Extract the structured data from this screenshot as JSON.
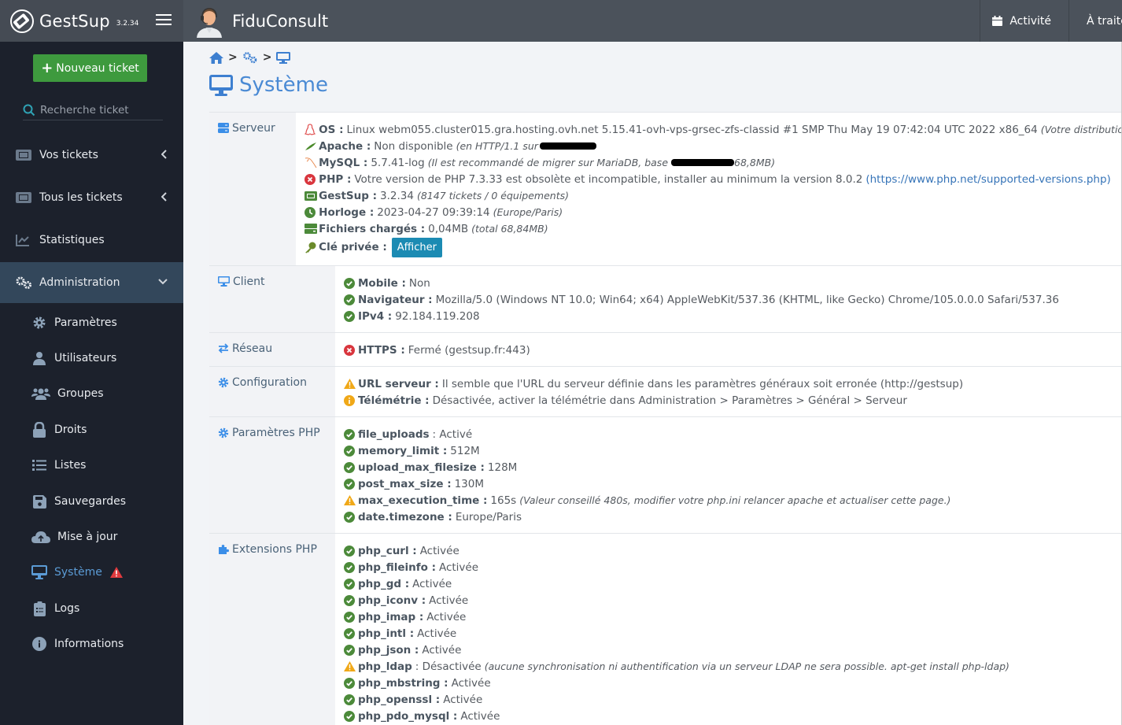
{
  "app": {
    "name": "GestSup",
    "version": "3.2.34",
    "organization": "FiduConsult"
  },
  "top_actions": [
    {
      "label": "Activité",
      "icon": "calendar-icon"
    },
    {
      "label": "À traiter",
      "icon": "flag-icon"
    }
  ],
  "sidebar": {
    "new_ticket_label": "Nouveau ticket",
    "search_placeholder": "Recherche ticket",
    "items": [
      {
        "label": "Vos tickets",
        "icon": "ticket-icon"
      },
      {
        "label": "Tous les tickets",
        "icon": "ticket-icon"
      },
      {
        "label": "Statistiques",
        "icon": "chart-line-icon"
      },
      {
        "label": "Administration",
        "icon": "cogs-icon"
      }
    ],
    "admin_items": [
      {
        "label": "Paramètres",
        "icon": "gear-icon"
      },
      {
        "label": "Utilisateurs",
        "icon": "user-icon"
      },
      {
        "label": "Groupes",
        "icon": "users-icon"
      },
      {
        "label": "Droits",
        "icon": "lock-icon"
      },
      {
        "label": "Listes",
        "icon": "list-icon"
      },
      {
        "label": "Sauvegardes",
        "icon": "save-icon"
      },
      {
        "label": "Mise à jour",
        "icon": "cloud-upload-icon"
      },
      {
        "label": "Système",
        "icon": "desktop-icon"
      },
      {
        "label": "Logs",
        "icon": "clipboard-list-icon"
      },
      {
        "label": "Informations",
        "icon": "info-circle-icon"
      }
    ]
  },
  "page": {
    "title": "Système",
    "breadcrumb": [
      "home-icon",
      "cogs-icon",
      "desktop-icon"
    ]
  },
  "sections": {
    "serveur": {
      "label": "Serveur",
      "os_key": "OS :",
      "os_value": "Linux webm055.cluster015.gra.hosting.ovh.net 5.15.41-ovh-vps-grsec-zfs-classid #1 SMP Thu May 19 07:42:04 UTC 2022 x86_64",
      "os_note": "(Votre distribution",
      "apache_key": "Apache :",
      "apache_value": "Non disponible",
      "apache_note": "(en HTTP/1.1 sur",
      "mysql_key": "MySQL :",
      "mysql_value": "5.7.41-log",
      "mysql_note": "(Il est recommandé de migrer sur MariaDB, base",
      "mysql_note_end": "68,8MB)",
      "php_key": "PHP :",
      "php_value": "Votre version de PHP 7.3.33 est obsolète et incompatible, installer au minimum la version 8.0.2",
      "php_link": "(https://www.php.net/supported-versions.php)",
      "gestsup_key": "GestSup :",
      "gestsup_value": "3.2.34",
      "gestsup_note": "(8147 tickets / 0 équipements)",
      "horloge_key": "Horloge :",
      "horloge_value": "2023-04-27 09:39:14",
      "horloge_note": "(Europe/Paris)",
      "fichiers_key": "Fichiers chargés :",
      "fichiers_value": "0,04MB",
      "fichiers_note": "(total 68,84MB)",
      "cle_key": "Clé privée :",
      "cle_button": "Afficher"
    },
    "client": {
      "label": "Client",
      "lines": [
        {
          "key": "Mobile :",
          "value": "Non",
          "status": "ok"
        },
        {
          "key": "Navigateur :",
          "value": "Mozilla/5.0 (Windows NT 10.0; Win64; x64) AppleWebKit/537.36 (KHTML, like Gecko) Chrome/105.0.0.0 Safari/537.36",
          "status": "ok"
        },
        {
          "key": "IPv4 :",
          "value": "92.184.119.208",
          "status": "ok"
        }
      ]
    },
    "reseau": {
      "label": "Réseau",
      "lines": [
        {
          "key": "HTTPS :",
          "value": "Fermé (gestsup.fr:443)",
          "status": "error"
        }
      ]
    },
    "configuration": {
      "label": "Configuration",
      "lines": [
        {
          "key": "URL serveur :",
          "value": "Il semble que l'URL du serveur définie dans les paramètres généraux soit erronée (http://gestsup)",
          "status": "warning"
        },
        {
          "key": "Télémétrie :",
          "value": "Désactivée, activer la télémétrie dans Administration > Paramètres > Général > Serveur",
          "status": "info"
        }
      ]
    },
    "parametres_php": {
      "label": "Paramètres PHP",
      "lines": [
        {
          "key": "file_uploads",
          "value": ": Activé",
          "status": "ok"
        },
        {
          "key": "memory_limit :",
          "value": "512M",
          "status": "ok"
        },
        {
          "key": "upload_max_filesize :",
          "value": "128M",
          "status": "ok"
        },
        {
          "key": "post_max_size :",
          "value": "130M",
          "status": "ok"
        },
        {
          "key": "max_execution_time :",
          "value": "165s",
          "note": "(Valeur conseillé 480s, modifier votre php.ini relancer apache et actualiser cette page.)",
          "status": "warning"
        },
        {
          "key": "date.timezone :",
          "value": "Europe/Paris",
          "status": "ok"
        }
      ]
    },
    "extensions_php": {
      "label": "Extensions PHP",
      "lines": [
        {
          "key": "php_curl :",
          "value": "Activée",
          "status": "ok"
        },
        {
          "key": "php_fileinfo :",
          "value": "Activée",
          "status": "ok"
        },
        {
          "key": "php_gd :",
          "value": "Activée",
          "status": "ok"
        },
        {
          "key": "php_iconv :",
          "value": "Activée",
          "status": "ok"
        },
        {
          "key": "php_imap :",
          "value": "Activée",
          "status": "ok"
        },
        {
          "key": "php_intl :",
          "value": "Activée",
          "status": "ok"
        },
        {
          "key": "php_json :",
          "value": "Activée",
          "status": "ok"
        },
        {
          "key": "php_ldap",
          "value": ": Désactivée",
          "note": "(aucune synchronisation ni authentification via un serveur LDAP ne sera possible. apt-get install php-ldap)",
          "status": "warning"
        },
        {
          "key": "php_mbstring :",
          "value": "Activée",
          "status": "ok"
        },
        {
          "key": "php_openssl :",
          "value": "Activée",
          "status": "ok"
        },
        {
          "key": "php_pdo_mysql :",
          "value": "Activée",
          "status": "ok"
        }
      ]
    }
  },
  "colors": {
    "accent": "#4a8ad4",
    "ok": "#4c8a3a",
    "error": "#d9363e",
    "warning": "#f0a818",
    "info": "#f0a818",
    "new_ticket": "#3e9a3e",
    "button": "#1c8bb3"
  }
}
